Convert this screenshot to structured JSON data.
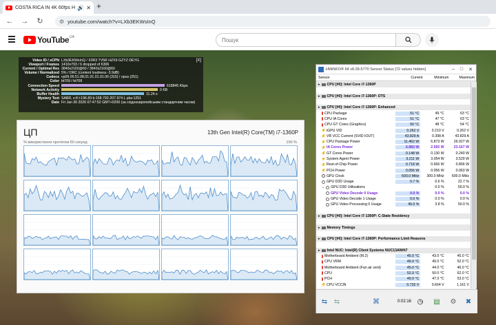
{
  "browser": {
    "tab_title": "COSTA RICA IN 4K 60fps H",
    "url": "youtube.com/watch?v=LXb3EKWsInQ",
    "search_placeholder": "Пошук",
    "logo_text": "YouTube",
    "logo_region": "UA"
  },
  "nerds": {
    "rows": [
      {
        "k": "Video ID / sCPN",
        "v": "LXb3EKWsInQ  /  X3R3  TV5R  HZX9  GZYZ  DEYG"
      },
      {
        "k": "Viewport / Frames",
        "v": "1410x793 / 6 dropped of 6306"
      },
      {
        "k": "Current / Optimal Res",
        "v": "3840x2160@60 / 3840x2160@60"
      },
      {
        "k": "Volume / Normalized",
        "v": "5% / DRC (content loudness -3.9dB)"
      },
      {
        "k": "Codecs",
        "v": "vp09.00.51.08.01.01.01.01.00 (315) / opus (251)"
      },
      {
        "k": "Color",
        "v": "bt709 / bt709"
      },
      {
        "k": "Connection Speed",
        "v": "618845 Kbps"
      },
      {
        "k": "Network Activity",
        "v": "0 KB"
      },
      {
        "k": "Buffer Health",
        "v": "11.24 s"
      },
      {
        "k": "Mystery Text",
        "v": "SABR, s:8 t:196.83 b:158.792-207.974 L pbs:1251"
      },
      {
        "k": "Date",
        "v": "Fri Jan 30 2026 07:47:52 GMT+0200 (за східноєвропейським стандартним часом)"
      }
    ],
    "close": "[X]"
  },
  "taskmgr": {
    "title": "ЦП",
    "cpu_name": "13th Gen Intel(R) Core(TM) i7-1360P",
    "subtitle": "% використання протягом 60 секунд",
    "max_label": "100 %",
    "graph_color": "#4a8ac8"
  },
  "hwinfo": {
    "title": "HWiNFO® 64 v8.28-5770 Sensor Status [72 values hidden]",
    "columns": [
      "Sensor",
      "Current",
      "Minimum",
      "Maximum"
    ],
    "time": "0:02:16",
    "rows": [
      {
        "t": "hdr",
        "name": "CPU [#0]: Intel Core i7-1360P"
      },
      {
        "t": "gap"
      },
      {
        "t": "hdr",
        "name": "CPU [#0]: Intel Core i7-1360P: DTS"
      },
      {
        "t": "gap"
      },
      {
        "t": "hdr",
        "name": "CPU [#0]: Intel Core i7-1360P: Enhanced"
      },
      {
        "t": "row",
        "ic": "therm",
        "name": "CPU Package",
        "cur": "51 °C",
        "min": "49 °C",
        "max": "63 °C"
      },
      {
        "t": "row",
        "ic": "therm",
        "name": "CPU IA Cores",
        "cur": "51 °C",
        "min": "47 °C",
        "max": "63 °C"
      },
      {
        "t": "row",
        "ic": "therm",
        "name": "CPU GT Cores (Graphics)",
        "cur": "50 °C",
        "min": "48 °C",
        "max": "54 °C"
      },
      {
        "t": "row",
        "ic": "bolt",
        "name": "iGPU VID",
        "cur": "0.262 V",
        "min": "0.210 V",
        "max": "0.262 V"
      },
      {
        "t": "row",
        "ic": "bolt",
        "name": "VR VCC Current (SVID IOUT)",
        "cur": "43.829 A",
        "min": "0.398 A",
        "max": "43.829 A"
      },
      {
        "t": "row",
        "ic": "bolt",
        "name": "CPU Package Power",
        "cur": "11.462 W",
        "min": "6.873 W",
        "max": "26.027 W"
      },
      {
        "t": "row",
        "ic": "bolt",
        "name": "IA Cores Power",
        "cur": "6.983 W",
        "min": "2.592 W",
        "max": "23.167 W",
        "purple": true
      },
      {
        "t": "row",
        "ic": "bolt",
        "name": "GT Cores Power",
        "cur": "0.148 W",
        "min": "0.130 W",
        "max": "0.240 W"
      },
      {
        "t": "row",
        "ic": "bolt",
        "name": "System Agent Power",
        "cur": "3.211 W",
        "min": "3.054 W",
        "max": "3.529 W"
      },
      {
        "t": "row",
        "ic": "bolt",
        "name": "Rest-of-Chip Power",
        "cur": "0.718 W",
        "min": "0.666 W",
        "max": "0.866 W"
      },
      {
        "t": "row",
        "ic": "bolt",
        "name": "PCH Power",
        "cur": "0.056 W",
        "min": "0.056 W",
        "max": "0.063 W"
      },
      {
        "t": "row",
        "ic": "clock",
        "name": "GPU Clock",
        "cur": "600.0 MHz",
        "min": "300.0 MHz",
        "max": "600.0 MHz"
      },
      {
        "t": "row",
        "ic": "pct",
        "name": "GPU D3D Usage",
        "cur": "0.7 %",
        "min": "0.6 %",
        "max": "22.7 %"
      },
      {
        "t": "row",
        "ic": "pct",
        "name": "GPU D3D Utilizations",
        "cur": "",
        "min": "0.0 %",
        "max": "50.0 %",
        "tw": "⌄"
      },
      {
        "t": "row",
        "ic": "pct",
        "name": "GPU Video Decode 0 Usage",
        "cur": "0.0 %",
        "min": "0.0 %",
        "max": "0.0 %",
        "purple": true,
        "sub": true
      },
      {
        "t": "row",
        "ic": "pct",
        "name": "GPU Video Decode 1 Usage",
        "cur": "0.0 %",
        "min": "0.0 %",
        "max": "0.0 %",
        "sub": true
      },
      {
        "t": "row",
        "ic": "pct",
        "name": "GPU Video Processing 0 Usage",
        "cur": "45.0 %",
        "min": "3.8 %",
        "max": "50.0 %",
        "sub": true
      },
      {
        "t": "gap"
      },
      {
        "t": "hdr",
        "name": "CPU [#0]: Intel Core i7-1360P: C-State Residency"
      },
      {
        "t": "gap"
      },
      {
        "t": "hdr",
        "name": "Memory Timings"
      },
      {
        "t": "gap"
      },
      {
        "t": "hdr",
        "name": "CPU [#0]: Intel Core i7-1360P: Performance Limit Reasons"
      },
      {
        "t": "gap"
      },
      {
        "t": "hdr",
        "name": "Intel NUC: Intel(R) Client Systems NUC13ANHi7"
      },
      {
        "t": "row",
        "ic": "therm",
        "name": "Motherboard Ambient (M.2)",
        "cur": "45.0 °C",
        "min": "43.0 °C",
        "max": "45.0 °C"
      },
      {
        "t": "row",
        "ic": "therm",
        "name": "CPU VRM",
        "cur": "49.0 °C",
        "min": "49.0 °C",
        "max": "52.0 °C"
      },
      {
        "t": "row",
        "ic": "therm",
        "name": "Motherboard Ambient (Fan air vent)",
        "cur": "45.0 °C",
        "min": "44.0 °C",
        "max": "46.0 °C"
      },
      {
        "t": "row",
        "ic": "therm",
        "name": "CPU",
        "cur": "52.0 °C",
        "min": "50.0 °C",
        "max": "62.0 °C"
      },
      {
        "t": "row",
        "ic": "therm",
        "name": "PCH",
        "cur": "49.0 °C",
        "min": "47.0 °C",
        "max": "53.0 °C"
      },
      {
        "t": "row",
        "ic": "bolt",
        "name": "CPU VCCIN",
        "cur": "0.732 V",
        "min": "0.664 V",
        "max": "1.161 V"
      }
    ]
  }
}
